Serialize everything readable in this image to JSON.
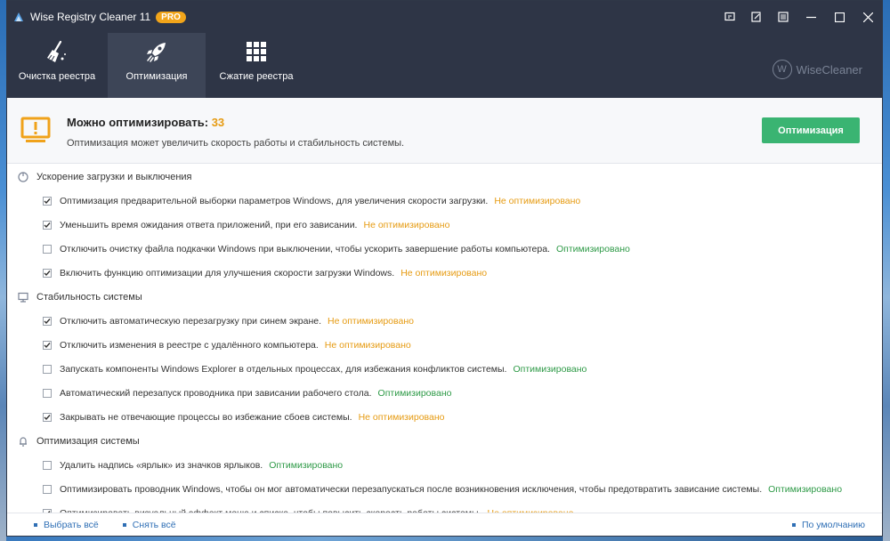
{
  "window": {
    "title": "Wise Registry Cleaner 11",
    "badge": "PRO"
  },
  "tabs": [
    {
      "label": "Очистка реестра",
      "icon": "broom-icon"
    },
    {
      "label": "Оптимизация",
      "icon": "rocket-icon",
      "active": true
    },
    {
      "label": "Сжатие реестра",
      "icon": "grid-icon"
    }
  ],
  "brand": {
    "letter": "W",
    "name": "WiseCleaner"
  },
  "header": {
    "title": "Можно оптимизировать:",
    "count": "33",
    "subtitle": "Оптимизация может увеличить скорость работы и стабильность системы.",
    "button": "Оптимизация"
  },
  "status_labels": {
    "not_optimized": "Не оптимизировано",
    "optimized": "Оптимизировано"
  },
  "sections": [
    {
      "title": "Ускорение загрузки и выключения",
      "icon": "power-icon",
      "items": [
        {
          "text": "Оптимизация предварительной выборки параметров Windows, для увеличения скорости загрузки.",
          "checked": true,
          "status": "Не оптимизировано"
        },
        {
          "text": "Уменьшить время ожидания ответа приложений, при его зависании.",
          "checked": true,
          "status": "Не оптимизировано"
        },
        {
          "text": "Отключить очистку файла подкачки Windows при выключении, чтобы ускорить завершение работы компьютера.",
          "checked": false,
          "status": "Оптимизировано"
        },
        {
          "text": "Включить функцию оптимизации для улучшения скорости загрузки Windows.",
          "checked": true,
          "status": "Не оптимизировано"
        }
      ]
    },
    {
      "title": "Стабильность системы",
      "icon": "monitor-icon",
      "items": [
        {
          "text": "Отключить автоматическую перезагрузку при синем экране.",
          "checked": true,
          "status": "Не оптимизировано"
        },
        {
          "text": "Отключить изменения в реестре с удалённого компьютера.",
          "checked": true,
          "status": "Не оптимизировано"
        },
        {
          "text": "Запускать компоненты Windows Explorer в отдельных процессах, для избежания конфликтов системы.",
          "checked": false,
          "status": "Оптимизировано"
        },
        {
          "text": "Автоматический перезапуск проводника при зависании рабочего стола.",
          "checked": false,
          "status": "Оптимизировано"
        },
        {
          "text": "Закрывать не отвечающие процессы во избежание сбоев системы.",
          "checked": true,
          "status": "Не оптимизировано"
        }
      ]
    },
    {
      "title": "Оптимизация системы",
      "icon": "bell-icon",
      "items": [
        {
          "text": "Удалить надпись «ярлык» из значков ярлыков.",
          "checked": false,
          "status": "Оптимизировано"
        },
        {
          "text": "Оптимизировать проводник Windows, чтобы он мог автоматически перезапускаться после возникновения исключения, чтобы предотвратить зависание системы.",
          "checked": false,
          "status": "Оптимизировано"
        },
        {
          "text": "Оптимизировать визуальный эффект меню и списка, чтобы повысить скорость работы системы.",
          "checked": true,
          "status": "Не оптимизировано"
        }
      ]
    }
  ],
  "footer": {
    "select_all": "Выбрать всё",
    "unselect_all": "Снять всё",
    "default": "По умолчанию"
  },
  "colors": {
    "titlebar": "#2e3546",
    "accent_orange": "#e69b12",
    "accent_green": "#2e9a47",
    "button_green": "#3ab472",
    "link_blue": "#2f6fb5"
  }
}
